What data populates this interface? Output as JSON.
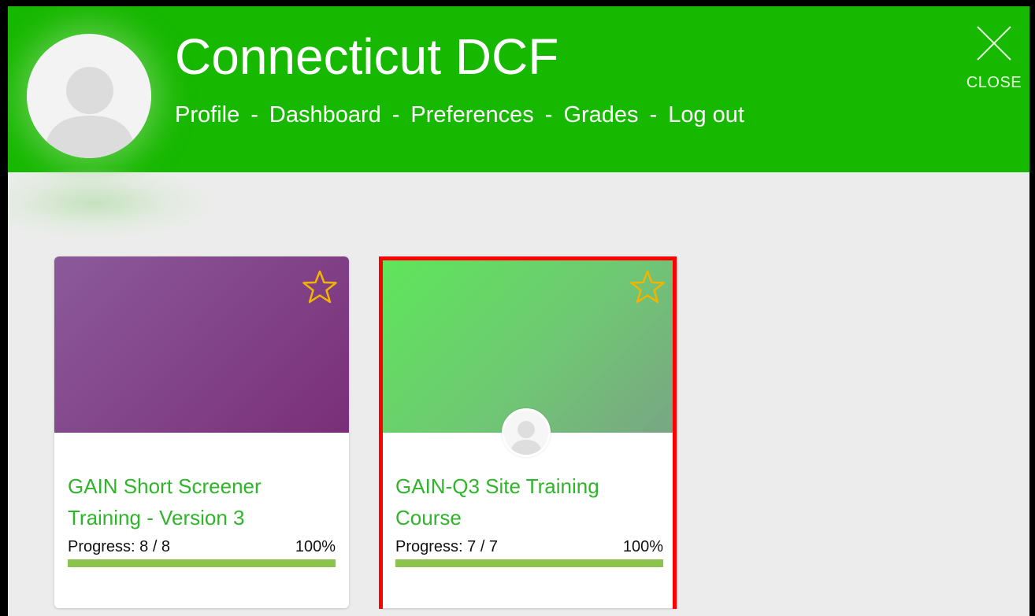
{
  "header": {
    "title": "Connecticut DCF",
    "nav": {
      "profile": "Profile",
      "dashboard": "Dashboard",
      "preferences": "Preferences",
      "grades": "Grades",
      "logout": "Log out",
      "separator": "-"
    },
    "close_label": "CLOSE"
  },
  "courses": [
    {
      "title": "GAIN Short Screener Training - Version 3",
      "progress_label": "Progress: 8 / 8",
      "progress_percent": "100%",
      "progress_value": 1.0,
      "image_colors": [
        "#8b5a9a",
        "#7a2f78"
      ]
    },
    {
      "title": "GAIN-Q3 Site Training Course",
      "progress_label": "Progress: 7 / 7",
      "progress_percent": "100%",
      "progress_value": 1.0,
      "image_colors": [
        "#5ee65a",
        "#7aa585"
      ]
    }
  ],
  "colors": {
    "header_bg": "#17b800",
    "course_title": "#2fb52a",
    "progress_fill": "#8dc24c",
    "star": "#f2b400",
    "highlight": "#ff0000"
  },
  "icons": {
    "avatar": "user-avatar-icon",
    "close": "close-x-icon",
    "favorite": "star-outline-icon"
  }
}
